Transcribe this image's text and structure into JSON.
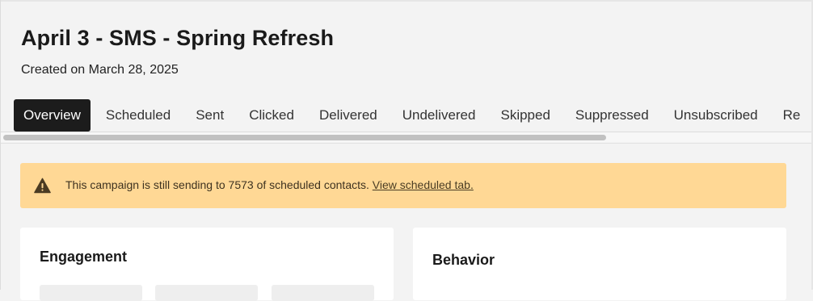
{
  "header": {
    "title": "April 3 - SMS - Spring Refresh",
    "subtitle": "Created on March 28, 2025"
  },
  "tabs": [
    {
      "label": "Overview",
      "active": true
    },
    {
      "label": "Scheduled",
      "active": false
    },
    {
      "label": "Sent",
      "active": false
    },
    {
      "label": "Clicked",
      "active": false
    },
    {
      "label": "Delivered",
      "active": false
    },
    {
      "label": "Undelivered",
      "active": false
    },
    {
      "label": "Skipped",
      "active": false
    },
    {
      "label": "Suppressed",
      "active": false
    },
    {
      "label": "Unsubscribed",
      "active": false
    },
    {
      "label": "Re",
      "active": false
    }
  ],
  "alert": {
    "icon": "warning-icon",
    "message": "This campaign is still sending to 7573 of scheduled contacts.",
    "link_text": "View scheduled tab.",
    "background_color": "#ffd895"
  },
  "cards": {
    "engagement": {
      "title": "Engagement"
    },
    "behavior": {
      "title": "Behavior"
    }
  },
  "colors": {
    "active_tab": "#1c1c1c",
    "page_background": "#f3f3f3"
  }
}
